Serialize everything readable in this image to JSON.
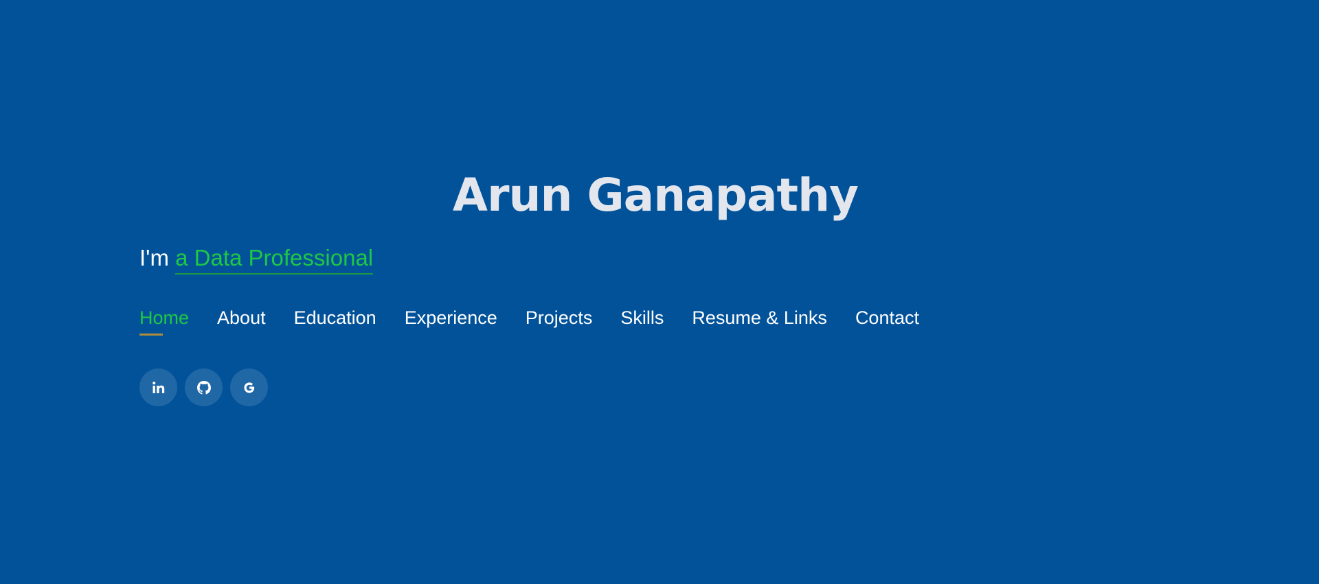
{
  "hero": {
    "name": "Arun Ganapathy",
    "tagline_prefix": "I'm",
    "tagline_typed": "a Data Professional"
  },
  "nav": {
    "items": [
      {
        "label": "Home",
        "active": true
      },
      {
        "label": "About"
      },
      {
        "label": "Education"
      },
      {
        "label": "Experience"
      },
      {
        "label": "Projects"
      },
      {
        "label": "Skills"
      },
      {
        "label": "Resume & Links"
      },
      {
        "label": "Contact"
      }
    ]
  },
  "social": {
    "icons": [
      "linkedin-icon",
      "github-icon",
      "google-icon"
    ]
  },
  "colors": {
    "background": "#02529a",
    "name_text": "#e3e7ed",
    "accent_green": "#1ec844",
    "active_underline": "#b08d3a"
  }
}
